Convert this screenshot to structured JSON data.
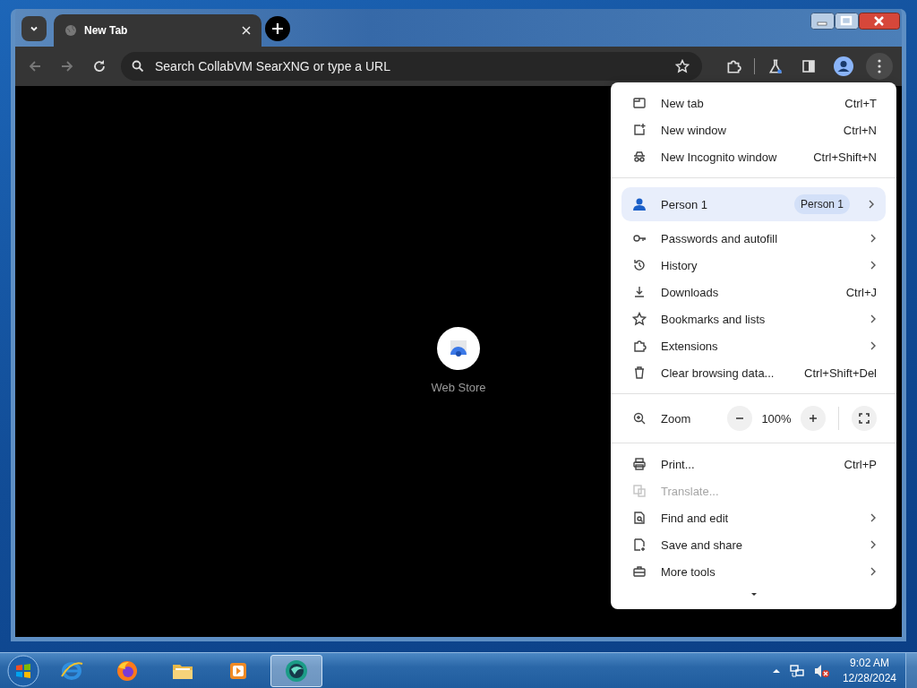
{
  "tab_strip": {
    "tabs": [
      {
        "title": "New Tab",
        "selected": true
      }
    ]
  },
  "toolbar": {
    "address_placeholder": "Search CollabVM SearXNG or type a URL"
  },
  "content": {
    "shortcuts": [
      {
        "label": "Web Store"
      }
    ]
  },
  "menu": {
    "sections": [
      {
        "items": [
          {
            "kind": "item",
            "label": "New tab",
            "shortcut": "Ctrl+T",
            "submenu": false,
            "disabled": false
          },
          {
            "kind": "item",
            "label": "New window",
            "shortcut": "Ctrl+N",
            "submenu": false,
            "disabled": false
          },
          {
            "kind": "item",
            "label": "New Incognito window",
            "shortcut": "Ctrl+Shift+N",
            "submenu": false,
            "disabled": false
          }
        ]
      },
      {
        "items": [
          {
            "kind": "profile",
            "label": "Person 1",
            "badge": "Person 1",
            "submenu": true
          },
          {
            "kind": "item",
            "label": "Passwords and autofill",
            "submenu": true,
            "disabled": false
          },
          {
            "kind": "item",
            "label": "History",
            "submenu": true,
            "disabled": false
          },
          {
            "kind": "item",
            "label": "Downloads",
            "shortcut": "Ctrl+J",
            "submenu": false,
            "disabled": false
          },
          {
            "kind": "item",
            "label": "Bookmarks and lists",
            "submenu": true,
            "disabled": false
          },
          {
            "kind": "item",
            "label": "Extensions",
            "submenu": true,
            "disabled": false
          },
          {
            "kind": "item",
            "label": "Clear browsing data...",
            "shortcut": "Ctrl+Shift+Del",
            "submenu": false,
            "disabled": false
          }
        ]
      },
      {
        "items": [
          {
            "kind": "zoom",
            "label": "Zoom",
            "value": "100%"
          }
        ]
      },
      {
        "items": [
          {
            "kind": "item",
            "label": "Print...",
            "shortcut": "Ctrl+P",
            "submenu": false,
            "disabled": false
          },
          {
            "kind": "item",
            "label": "Translate...",
            "submenu": false,
            "disabled": true
          },
          {
            "kind": "item",
            "label": "Find and edit",
            "submenu": true,
            "disabled": false
          },
          {
            "kind": "item",
            "label": "Save and share",
            "submenu": true,
            "disabled": false
          },
          {
            "kind": "item",
            "label": "More tools",
            "submenu": true,
            "disabled": false
          }
        ]
      }
    ]
  },
  "taskbar": {
    "apps": [
      {
        "selected": false
      },
      {
        "selected": false
      },
      {
        "selected": false
      },
      {
        "selected": false
      },
      {
        "selected": true
      }
    ],
    "clock": {
      "time": "9:02 AM",
      "date": "12/28/2024"
    }
  }
}
